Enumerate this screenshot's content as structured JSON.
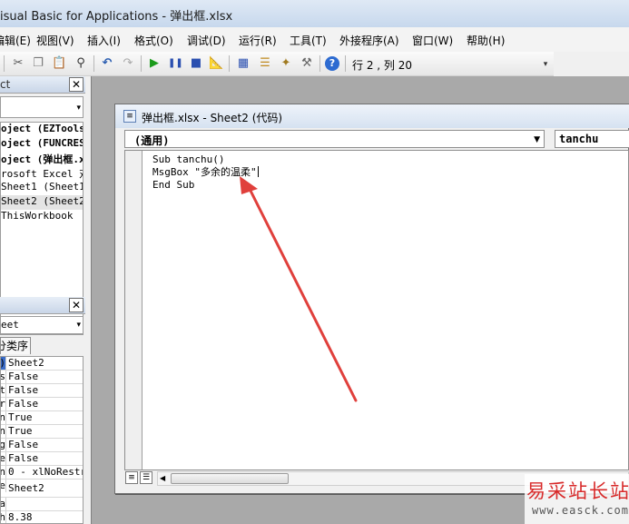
{
  "window": {
    "title": "isual Basic for Applications - 弹出框.xlsx"
  },
  "menu": {
    "items": [
      "编辑(E)",
      "视图(V)",
      "插入(I)",
      "格式(O)",
      "调试(D)",
      "运行(R)",
      "工具(T)",
      "外接程序(A)",
      "窗口(W)",
      "帮助(H)"
    ],
    "edit_label": "编辑(E)"
  },
  "toolbar": {
    "icons": [
      "cut-icon",
      "copy-icon",
      "paste-icon",
      "find-icon",
      "undo-icon",
      "redo-icon",
      "run-icon",
      "break-icon",
      "reset-icon",
      "design-mode-icon",
      "project-explorer-icon",
      "properties-icon",
      "object-browser-icon",
      "toolbox-icon",
      "help-icon"
    ],
    "cursor_position": "行 2 , 列 20"
  },
  "project_pane": {
    "title": "ct",
    "items": [
      {
        "text": "oject (EZTools",
        "bold": true
      },
      {
        "text": "oject (FUNCRES",
        "bold": true
      },
      {
        "text": "oject (弹出框.x",
        "bold": true
      },
      {
        "text": "rosoft Excel 对象",
        "bold": false
      },
      {
        "text": "Sheet1 (Sheet1)",
        "bold": false
      },
      {
        "text": "Sheet2 (Sheet2)",
        "bold": false
      },
      {
        "text": "ThisWorkbook",
        "bold": false
      }
    ]
  },
  "properties_pane": {
    "object_combo": "eet",
    "tab_label": "分类序",
    "rows": [
      {
        "name": "(Name)",
        "value": "Sheet2"
      },
      {
        "name": "DisplayPageBreaks",
        "value": "False"
      },
      {
        "name": "DisplayRightToLeft",
        "value": "False"
      },
      {
        "name": "EnableAutoFilter",
        "value": "False"
      },
      {
        "name": "EnableCalculation",
        "value": "True"
      },
      {
        "name": "EnableFormatConditionsCalculation",
        "value": "True"
      },
      {
        "name": "EnableOutlining",
        "value": "False"
      },
      {
        "name": "EnablePivotTable",
        "value": "False"
      },
      {
        "name": "EnableSelection",
        "value": "0 - xlNoRestr"
      },
      {
        "name": "Name",
        "value": "Sheet2"
      },
      {
        "name": "ScrollArea",
        "value": ""
      },
      {
        "name": "StandardWidth",
        "value": "8.38"
      }
    ]
  },
  "code_window": {
    "title": "弹出框.xlsx - Sheet2 (代码)",
    "object_combo": "(通用)",
    "procedure_combo": "tanchu",
    "lines": [
      "Sub tanchu()",
      "MsgBox \"多余的温柔\"",
      "End Sub"
    ]
  },
  "watermark": {
    "chinese": "易采站长站",
    "url": "www.easck.com"
  },
  "colors": {
    "arrow": "#e0403c",
    "title_gradient_top": "#dfe9f5",
    "mdi_background": "#a9a9a9"
  }
}
